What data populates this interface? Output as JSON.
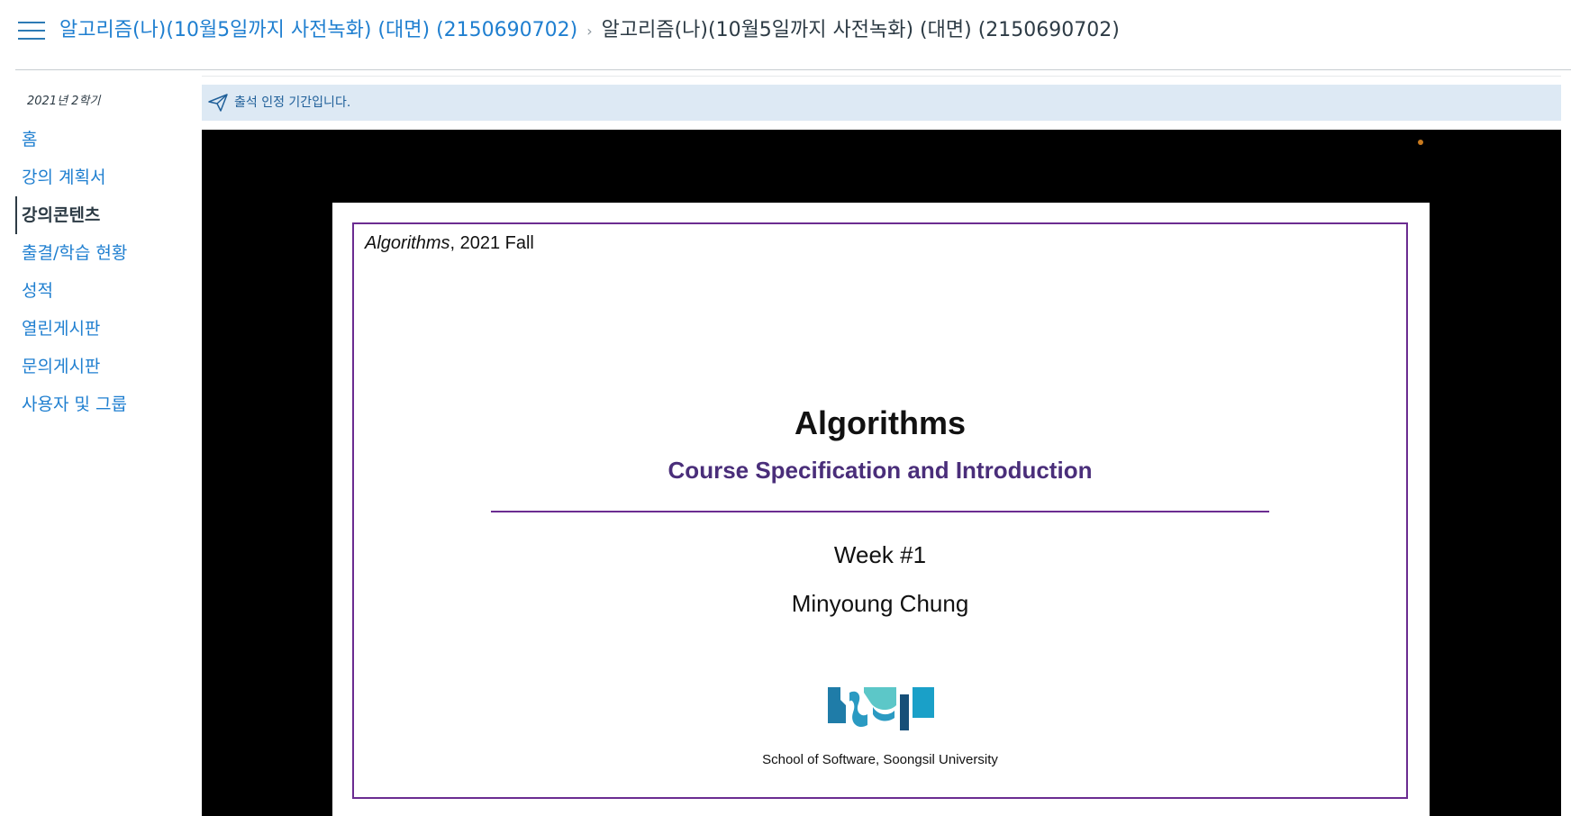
{
  "header": {
    "menu_icon": "hamburger-menu-icon",
    "breadcrumb_course_link": "알고리즘(나)(10월5일까지 사전녹화) (대면) (2150690702)",
    "breadcrumb_separator": "›",
    "breadcrumb_current": "알고리즘(나)(10월5일까지 사전녹화) (대면) (2150690702)"
  },
  "sidebar": {
    "term": "2021년 2학기",
    "items": [
      {
        "label": "홈",
        "active": false
      },
      {
        "label": "강의 계획서",
        "active": false
      },
      {
        "label": "강의콘텐츠",
        "active": true
      },
      {
        "label": "출결/학습 현황",
        "active": false
      },
      {
        "label": "성적",
        "active": false
      },
      {
        "label": "열린게시판",
        "active": false
      },
      {
        "label": "문의게시판",
        "active": false
      },
      {
        "label": "사용자 및 그룹",
        "active": false
      }
    ]
  },
  "notice": {
    "icon": "paper-plane-icon",
    "text": "출석 인정 기간입니다."
  },
  "slide": {
    "course_italic": "Algorithms",
    "course_rest": ", 2021 Fall",
    "title": "Algorithms",
    "subtitle": "Course Specification and Introduction",
    "week": "Week #1",
    "author": "Minyoung Chung",
    "logo": "ssu-logo",
    "school": "School of Software, Soongsil University"
  },
  "colors": {
    "link": "#1f7fd0",
    "text": "#2d3b45",
    "notice_bg": "#dde9f4",
    "slide_accent": "#6b2c91",
    "subtitle": "#4a2e7a",
    "player_bg": "#000000"
  }
}
